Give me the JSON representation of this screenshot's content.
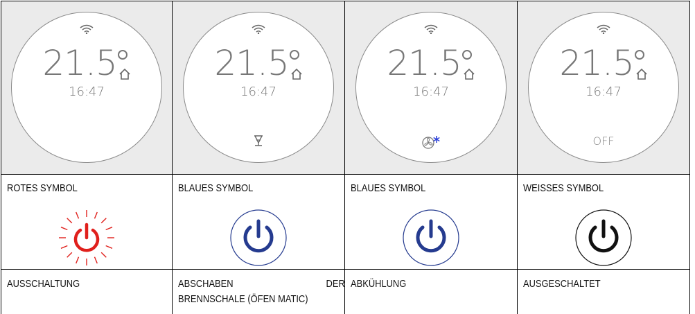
{
  "panels": [
    {
      "temperature": "21.5",
      "time": "16:47",
      "status_icon": "none",
      "status_text": "",
      "symbol_label": "ROTES SYMBOL",
      "symbol_color": "#e0201c",
      "symbol_style": "glowing-red",
      "description_lines": [
        "AUSSCHALTUNG"
      ]
    },
    {
      "temperature": "21.5",
      "time": "16:47",
      "status_icon": "scraper-icon",
      "status_text": "",
      "symbol_label": "BLAUES SYMBOL",
      "symbol_color": "#253b8f",
      "symbol_style": "blue-ring",
      "description_lines": [
        "ABSCHABEN DER",
        "BRENNSCHALE (ÖFEN MATIC)"
      ]
    },
    {
      "temperature": "21.5",
      "time": "16:47",
      "status_icon": "fan-snowflake-icon",
      "status_text": "",
      "symbol_label": "BLAUES SYMBOL",
      "symbol_color": "#253b8f",
      "symbol_style": "blue-ring",
      "description_lines": [
        "ABKÜHLUNG"
      ]
    },
    {
      "temperature": "21.5",
      "time": "16:47",
      "status_icon": "none",
      "status_text": "OFF",
      "symbol_label": "WEISSES SYMBOL",
      "symbol_color": "#111111",
      "symbol_style": "black-ring",
      "description_lines": [
        "AUSGESCHALTET"
      ]
    }
  ],
  "desc_split": {
    "word_a": "ABSCHABEN",
    "word_b": "DER"
  },
  "icons": {
    "wifi": "wifi-icon",
    "house": "house-icon",
    "degree": "degree-icon",
    "power": "power-icon"
  }
}
